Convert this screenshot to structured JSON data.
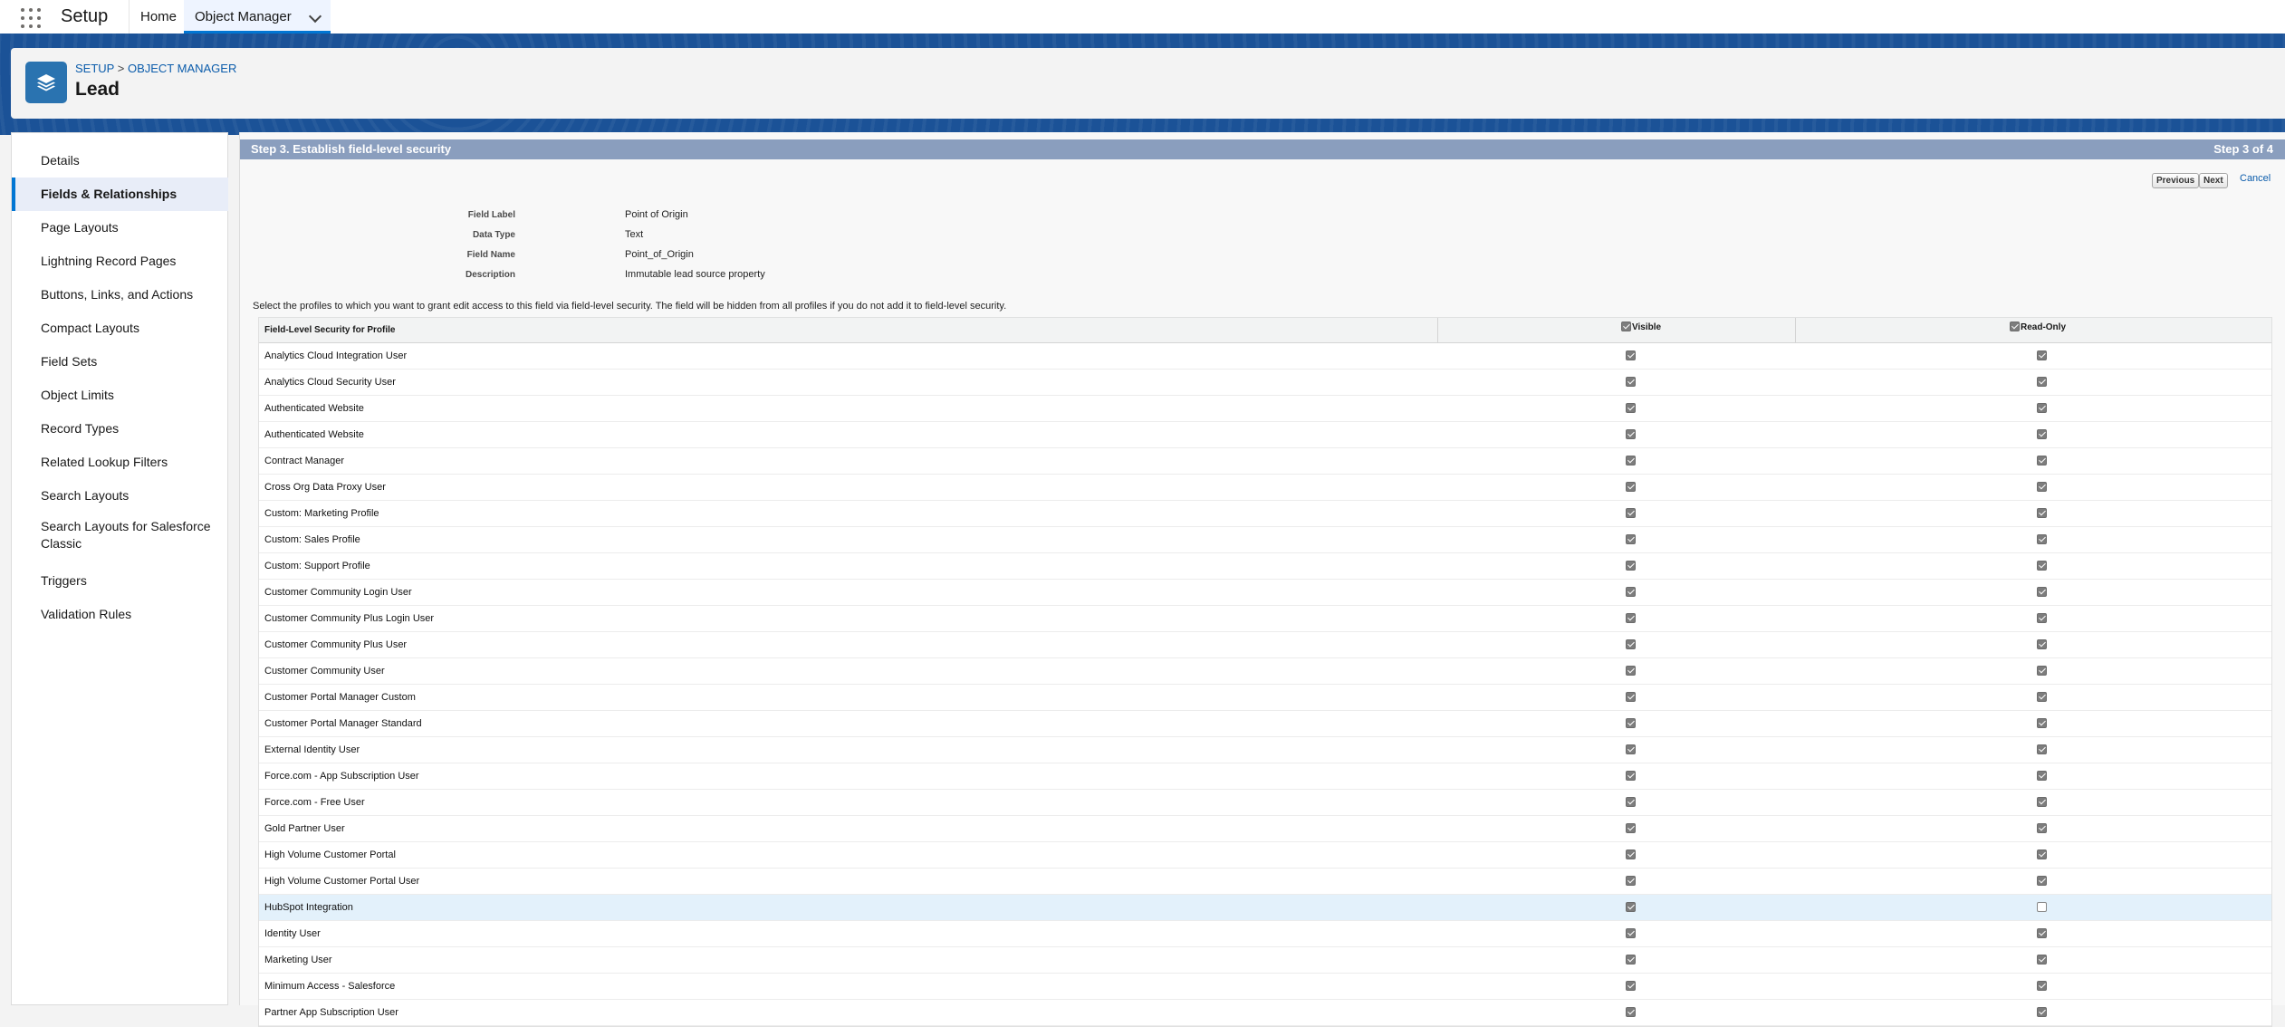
{
  "nav": {
    "app_name": "Setup",
    "tabs": [
      "Home",
      "Object Manager"
    ]
  },
  "header": {
    "breadcrumb": [
      "SETUP",
      "OBJECT MANAGER"
    ],
    "breadcrumb_sep": ">",
    "title": "Lead"
  },
  "sidebar": {
    "items": [
      {
        "label": "Details",
        "active": false
      },
      {
        "label": "Fields & Relationships",
        "active": true
      },
      {
        "label": "Page Layouts",
        "active": false
      },
      {
        "label": "Lightning Record Pages",
        "active": false
      },
      {
        "label": "Buttons, Links, and Actions",
        "active": false
      },
      {
        "label": "Compact Layouts",
        "active": false
      },
      {
        "label": "Field Sets",
        "active": false
      },
      {
        "label": "Object Limits",
        "active": false
      },
      {
        "label": "Record Types",
        "active": false
      },
      {
        "label": "Related Lookup Filters",
        "active": false
      },
      {
        "label": "Search Layouts",
        "active": false
      },
      {
        "label": "Search Layouts for Salesforce Classic",
        "active": false
      },
      {
        "label": "Triggers",
        "active": false
      },
      {
        "label": "Validation Rules",
        "active": false
      }
    ]
  },
  "step": {
    "title": "Step 3. Establish field-level security",
    "progress": "Step 3 of 4"
  },
  "buttons": {
    "previous": "Previous",
    "next": "Next",
    "cancel": "Cancel"
  },
  "field": {
    "label_label": "Field Label",
    "label_value": "Point of Origin",
    "type_label": "Data Type",
    "type_value": "Text",
    "name_label": "Field Name",
    "name_value": "Point_of_Origin",
    "desc_label": "Description",
    "desc_value": "Immutable lead source property"
  },
  "instructions": "Select the profiles to which you want to grant edit access to this field via field-level security. The field will be hidden from all profiles if you do not add it to field-level security.",
  "table": {
    "col_profile": "Field-Level Security for Profile",
    "col_visible": "Visible",
    "col_readonly": "Read-Only",
    "rows": [
      {
        "profile": "Analytics Cloud Integration User",
        "visible": true,
        "read_only": true
      },
      {
        "profile": "Analytics Cloud Security User",
        "visible": true,
        "read_only": true
      },
      {
        "profile": "Authenticated Website",
        "visible": true,
        "read_only": true
      },
      {
        "profile": "Authenticated Website",
        "visible": true,
        "read_only": true
      },
      {
        "profile": "Contract Manager",
        "visible": true,
        "read_only": true
      },
      {
        "profile": "Cross Org Data Proxy User",
        "visible": true,
        "read_only": true
      },
      {
        "profile": "Custom: Marketing Profile",
        "visible": true,
        "read_only": true
      },
      {
        "profile": "Custom: Sales Profile",
        "visible": true,
        "read_only": true
      },
      {
        "profile": "Custom: Support Profile",
        "visible": true,
        "read_only": true
      },
      {
        "profile": "Customer Community Login User",
        "visible": true,
        "read_only": true
      },
      {
        "profile": "Customer Community Plus Login User",
        "visible": true,
        "read_only": true
      },
      {
        "profile": "Customer Community Plus User",
        "visible": true,
        "read_only": true
      },
      {
        "profile": "Customer Community User",
        "visible": true,
        "read_only": true
      },
      {
        "profile": "Customer Portal Manager Custom",
        "visible": true,
        "read_only": true
      },
      {
        "profile": "Customer Portal Manager Standard",
        "visible": true,
        "read_only": true
      },
      {
        "profile": "External Identity User",
        "visible": true,
        "read_only": true
      },
      {
        "profile": "Force.com - App Subscription User",
        "visible": true,
        "read_only": true
      },
      {
        "profile": "Force.com - Free User",
        "visible": true,
        "read_only": true
      },
      {
        "profile": "Gold Partner User",
        "visible": true,
        "read_only": true
      },
      {
        "profile": "High Volume Customer Portal",
        "visible": true,
        "read_only": true
      },
      {
        "profile": "High Volume Customer Portal User",
        "visible": true,
        "read_only": true
      },
      {
        "profile": "HubSpot Integration",
        "visible": true,
        "read_only": false,
        "highlighted": true
      },
      {
        "profile": "Identity User",
        "visible": true,
        "read_only": true
      },
      {
        "profile": "Marketing User",
        "visible": true,
        "read_only": true
      },
      {
        "profile": "Minimum Access - Salesforce",
        "visible": true,
        "read_only": true
      },
      {
        "profile": "Partner App Subscription User",
        "visible": true,
        "read_only": true
      }
    ]
  },
  "icons": {
    "launcher": "app-launcher-icon",
    "object": "layers-icon",
    "tab_menu": "chevron-down-icon"
  },
  "colors": {
    "brand_band": "#1b5297",
    "step_bar": "#8a9ebe",
    "link": "#0b5cab",
    "active_accent": "#0176d3"
  }
}
